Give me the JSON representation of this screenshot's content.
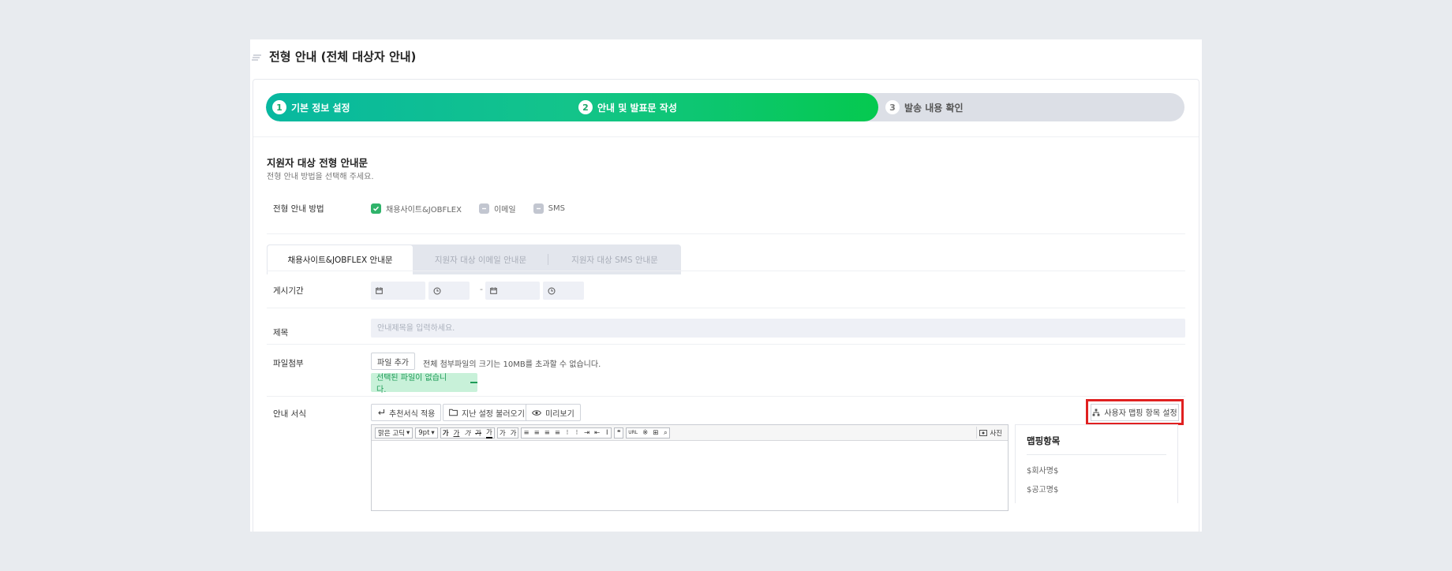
{
  "page": {
    "title": "전형 안내 (전체 대상자 안내)"
  },
  "steps": [
    {
      "num": "1",
      "label": "기본 정보 설정"
    },
    {
      "num": "2",
      "label": "안내 및 발표문 작성"
    },
    {
      "num": "3",
      "label": "발송 내용 확인"
    }
  ],
  "section": {
    "title": "지원자 대상 전형 안내문",
    "subtitle": "전형 안내 방법을 선택해 주세요."
  },
  "method": {
    "label": "전형 안내 방법",
    "options": [
      {
        "label": "채용사이트&JOBFLEX"
      },
      {
        "label": "이메일"
      },
      {
        "label": "SMS"
      }
    ]
  },
  "tabs": [
    {
      "label": "채용사이트&JOBFLEX 안내문"
    },
    {
      "label": "지원자 대상 이메일 안내문"
    },
    {
      "label": "지원자 대상 SMS 안내문"
    }
  ],
  "period": {
    "label": "게시기간",
    "separator": "-"
  },
  "subject": {
    "label": "제목",
    "placeholder": "안내제목을 입력하세요."
  },
  "attachment": {
    "label": "파일첨부",
    "add_button": "파일 추가",
    "note": "전체 첨부파일의 크기는 10MB를 초과할 수 없습니다.",
    "empty": "선택된 파일이 없습니다."
  },
  "guide": {
    "label": "안내 서식",
    "recommend_button": "추천서식 적용",
    "load_button": "지난 설정 불러오기",
    "preview_button": "미리보기",
    "mapping_button": "사용자 맵핑 항목 설정"
  },
  "editor": {
    "font": "맑은 고딕",
    "size": "9pt",
    "photo": "사진",
    "toolbar_groups": [
      [
        "가",
        "가",
        "가",
        "가",
        "가"
      ],
      [
        "가",
        "가"
      ],
      [
        "≡",
        "≡",
        "≡",
        "≡",
        "⁝",
        "⁝",
        "⇥",
        "⇤",
        "Ⅰ"
      ],
      [
        "❝"
      ],
      [
        "URL",
        "※",
        "⊞",
        "⌕"
      ]
    ]
  },
  "mapping": {
    "title": "맵핑항목",
    "items": [
      "$회사명$",
      "$공고명$"
    ]
  }
}
